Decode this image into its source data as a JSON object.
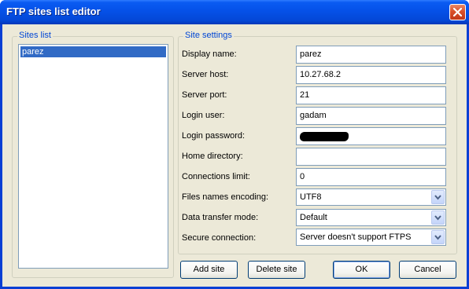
{
  "window": {
    "title": "FTP sites list editor"
  },
  "sites_list": {
    "legend": "Sites list",
    "items": [
      {
        "label": "parez",
        "selected": true
      }
    ]
  },
  "site_settings": {
    "legend": "Site settings",
    "fields": {
      "display_name": {
        "label": "Display name:",
        "value": "parez"
      },
      "server_host": {
        "label": "Server host:",
        "value": "10.27.68.2"
      },
      "server_port": {
        "label": "Server port:",
        "value": "21"
      },
      "login_user": {
        "label": "Login user:",
        "value": "gadam"
      },
      "login_password": {
        "label": "Login password:",
        "value": ""
      },
      "home_directory": {
        "label": "Home directory:",
        "value": ""
      },
      "connections_limit": {
        "label": "Connections limit:",
        "value": "0"
      },
      "files_names_encoding": {
        "label": "Files names encoding:",
        "value": "UTF8"
      },
      "data_transfer_mode": {
        "label": "Data transfer mode:",
        "value": "Default"
      },
      "secure_connection": {
        "label": "Secure connection:",
        "value": "Server doesn't support FTPS"
      }
    }
  },
  "buttons": {
    "add_site": "Add site",
    "delete_site": "Delete site",
    "ok": "OK",
    "cancel": "Cancel"
  },
  "icons": {
    "close": "close-icon",
    "dropdown": "chevron-down-icon"
  },
  "colors": {
    "titlebar": "#0551e8",
    "dialog_bg": "#ece9d8",
    "group_legend": "#0046d5",
    "selection": "#316ac5",
    "close_button": "#d9502a"
  }
}
